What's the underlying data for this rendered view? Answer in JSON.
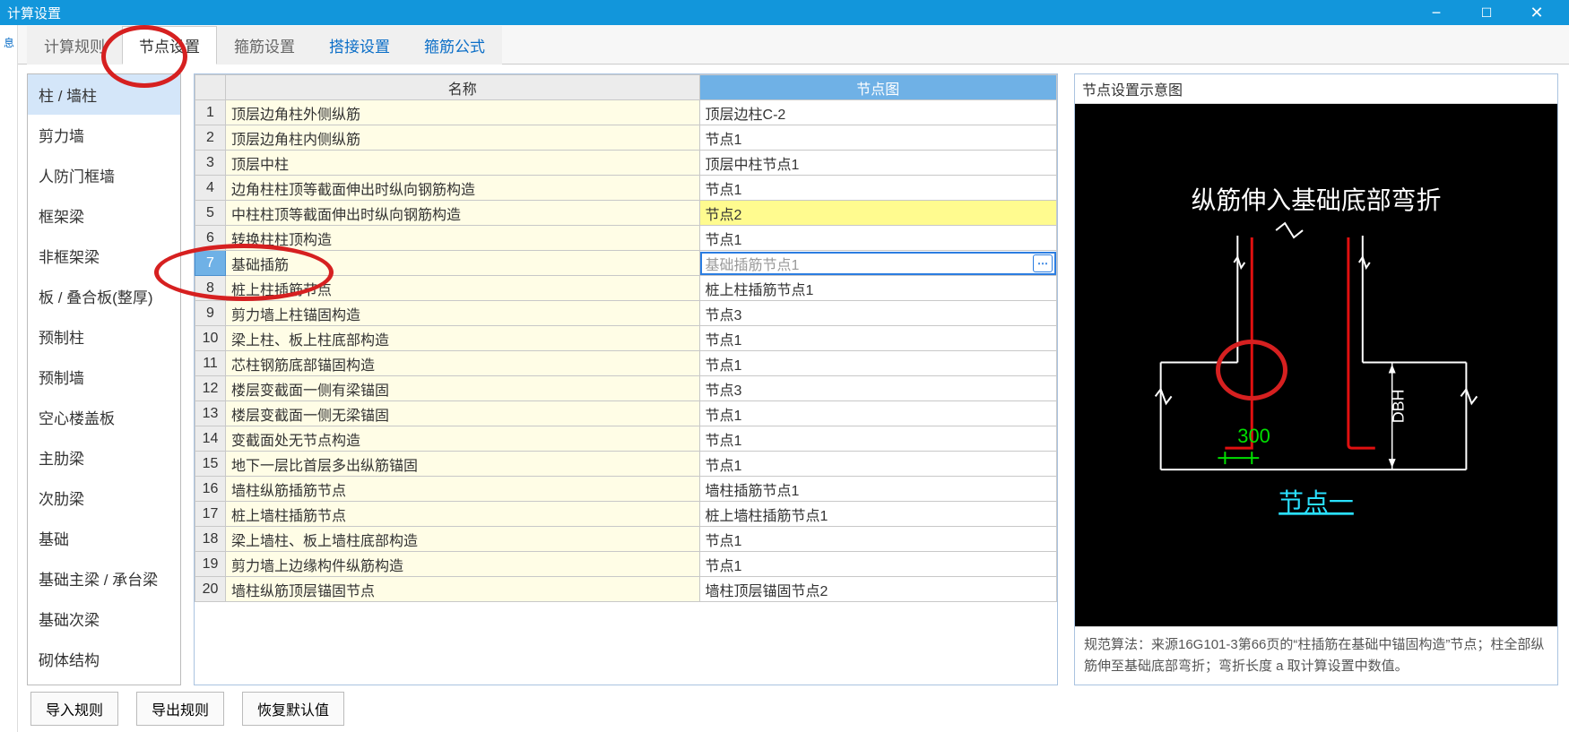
{
  "titlebar": {
    "title": "计算设置"
  },
  "tabs": [
    {
      "label": "计算规则",
      "active": false,
      "blue": false
    },
    {
      "label": "节点设置",
      "active": true,
      "blue": false
    },
    {
      "label": "箍筋设置",
      "active": false,
      "blue": false
    },
    {
      "label": "搭接设置",
      "active": false,
      "blue": true
    },
    {
      "label": "箍筋公式",
      "active": false,
      "blue": true
    }
  ],
  "sidebar": {
    "items": [
      "柱 / 墙柱",
      "剪力墙",
      "人防门框墙",
      "框架梁",
      "非框架梁",
      "板 / 叠合板(整厚)",
      "预制柱",
      "预制墙",
      "空心楼盖板",
      "主肋梁",
      "次肋梁",
      "基础",
      "基础主梁 / 承台梁",
      "基础次梁",
      "砌体结构"
    ],
    "selected_index": 0
  },
  "grid": {
    "headers": {
      "rownum": "",
      "name": "名称",
      "node": "节点图"
    },
    "rows": [
      {
        "n": 1,
        "name": "顶层边角柱外侧纵筋",
        "node": "顶层边柱C-2"
      },
      {
        "n": 2,
        "name": "顶层边角柱内侧纵筋",
        "node": "节点1"
      },
      {
        "n": 3,
        "name": "顶层中柱",
        "node": "顶层中柱节点1"
      },
      {
        "n": 4,
        "name": "边角柱柱顶等截面伸出时纵向钢筋构造",
        "node": "节点1"
      },
      {
        "n": 5,
        "name": "中柱柱顶等截面伸出时纵向钢筋构造",
        "node": "节点2",
        "hl": true
      },
      {
        "n": 6,
        "name": "转换柱柱顶构造",
        "node": "节点1"
      },
      {
        "n": 7,
        "name": "基础插筋",
        "node": "基础插筋节点1",
        "selected": true
      },
      {
        "n": 8,
        "name": "桩上柱插筋节点",
        "node": "桩上柱插筋节点1"
      },
      {
        "n": 9,
        "name": "剪力墙上柱锚固构造",
        "node": "节点3"
      },
      {
        "n": 10,
        "name": "梁上柱、板上柱底部构造",
        "node": "节点1"
      },
      {
        "n": 11,
        "name": "芯柱钢筋底部锚固构造",
        "node": "节点1"
      },
      {
        "n": 12,
        "name": "楼层变截面一侧有梁锚固",
        "node": "节点3"
      },
      {
        "n": 13,
        "name": "楼层变截面一侧无梁锚固",
        "node": "节点1"
      },
      {
        "n": 14,
        "name": "变截面处无节点构造",
        "node": "节点1"
      },
      {
        "n": 15,
        "name": "地下一层比首层多出纵筋锚固",
        "node": "节点1"
      },
      {
        "n": 16,
        "name": "墙柱纵筋插筋节点",
        "node": "墙柱插筋节点1"
      },
      {
        "n": 17,
        "name": "桩上墙柱插筋节点",
        "node": "桩上墙柱插筋节点1"
      },
      {
        "n": 18,
        "name": "梁上墙柱、板上墙柱底部构造",
        "node": "节点1"
      },
      {
        "n": 19,
        "name": "剪力墙上边缘构件纵筋构造",
        "node": "节点1"
      },
      {
        "n": 20,
        "name": "墙柱纵筋顶层锚固节点",
        "node": "墙柱顶层锚固节点2"
      }
    ]
  },
  "diagram": {
    "panel_title": "节点设置示意图",
    "title": "纵筋伸入基础底部弯折",
    "dim_value": "300",
    "dbh_label": "DBH",
    "node_label": "节点一",
    "description": "规范算法：来源16G101-3第66页的“柱插筋在基础中锚固构造”节点；柱全部纵筋伸至基础底部弯折；弯折长度 a 取计算设置中数值。"
  },
  "footer": {
    "import": "导入规则",
    "export": "导出规则",
    "restore": "恢复默认值"
  }
}
